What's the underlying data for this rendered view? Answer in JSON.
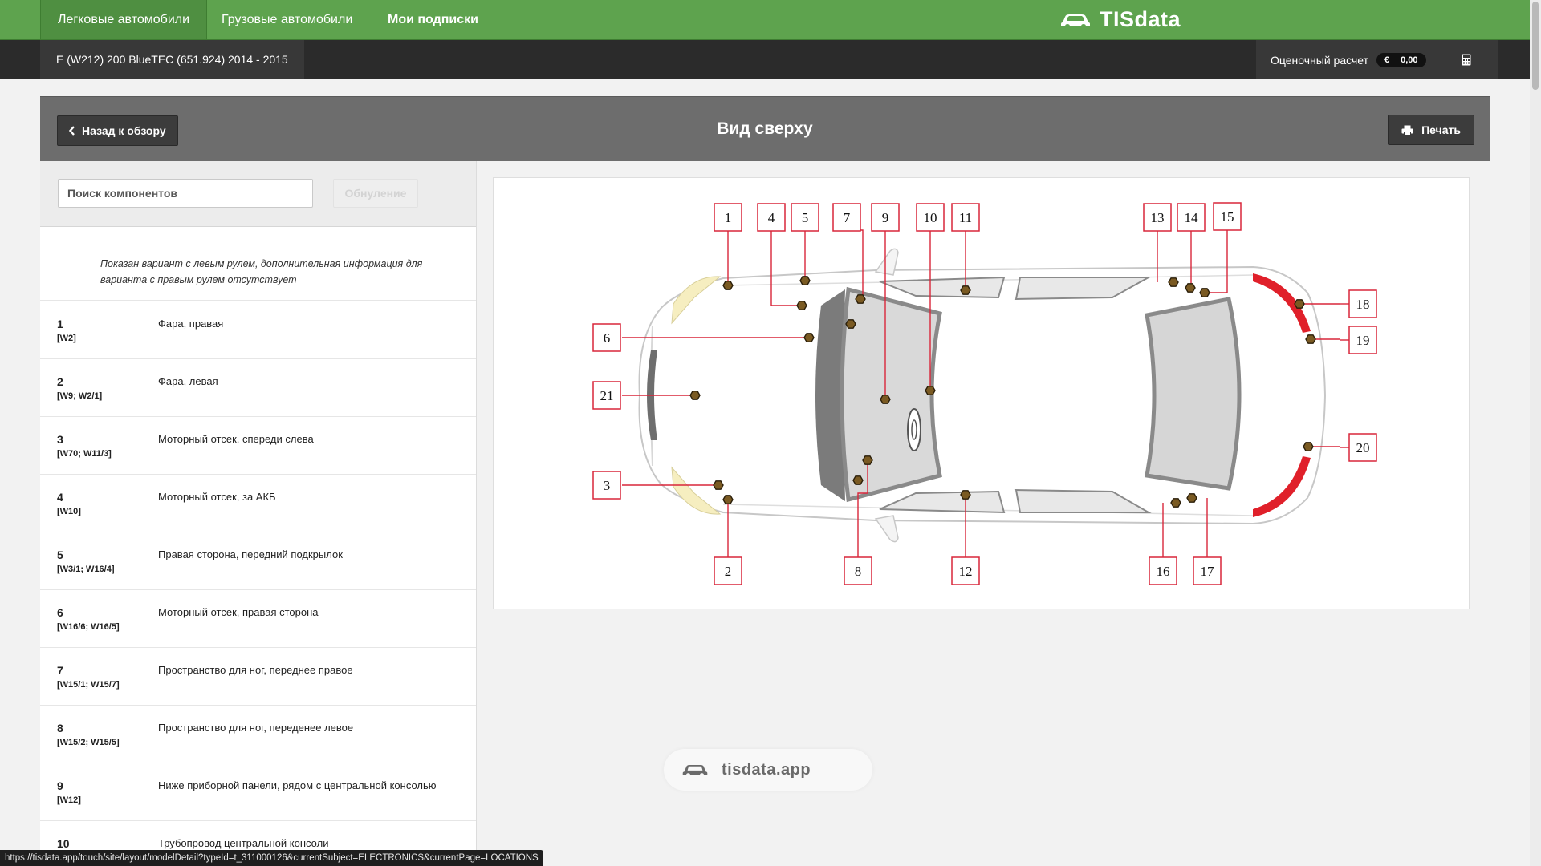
{
  "topnav": {
    "tabs": [
      {
        "label": "Легковые автомобили",
        "active": true
      },
      {
        "label": "Грузовые автомобили",
        "active": false
      },
      {
        "label": "Мои подписки",
        "active": false
      }
    ],
    "brand": "TISdata",
    "brand_icon": "car-icon"
  },
  "subbar": {
    "vehicle": "E (W212) 200 BlueTEC (651.924) 2014 - 2015",
    "estimate_label": "Оценочный расчет",
    "currency": "€",
    "amount": "0,00",
    "calc_icon": "calculator-icon"
  },
  "page": {
    "back_label": "Назад к обзору",
    "title": "Вид сверху",
    "print_label": "Печать"
  },
  "search": {
    "placeholder": "Поиск компонентов",
    "value": "",
    "reset_label": "Обнуление"
  },
  "note": "Показан вариант с левым рулем, дополнительная информация для варианта с правым рулем отсутствует",
  "components": [
    {
      "num": "1",
      "code": "[W2]",
      "desc": "Фара, правая"
    },
    {
      "num": "2",
      "code": "[W9; W2/1]",
      "desc": "Фара, левая"
    },
    {
      "num": "3",
      "code": "[W70; W11/3]",
      "desc": "Моторный отсек, спереди слева"
    },
    {
      "num": "4",
      "code": "[W10]",
      "desc": "Моторный отсек, за АКБ"
    },
    {
      "num": "5",
      "code": "[W3/1; W16/4]",
      "desc": "Правая сторона, передний подкрылок"
    },
    {
      "num": "6",
      "code": "[W16/6; W16/5]",
      "desc": "Моторный отсек, правая сторона"
    },
    {
      "num": "7",
      "code": "[W15/1; W15/7]",
      "desc": "Пространство для ног, переднее правое"
    },
    {
      "num": "8",
      "code": "[W15/2; W15/5]",
      "desc": "Пространство для ног, переденее левое"
    },
    {
      "num": "9",
      "code": "[W12]",
      "desc": "Ниже приборной панели, рядом с центральной консолью"
    },
    {
      "num": "10",
      "code": "",
      "desc": "Трубопровод центральной консоли"
    }
  ],
  "diagram": {
    "labels": [
      "1",
      "2",
      "3",
      "4",
      "5",
      "6",
      "7",
      "8",
      "9",
      "10",
      "11",
      "12",
      "13",
      "14",
      "15",
      "16",
      "17",
      "18",
      "19",
      "20",
      "21"
    ],
    "label_color": "#d9263a",
    "marker_color": "#7a5a22",
    "highlight_color": "#e0202a"
  },
  "watermark": "tisdata.app",
  "statusbar": "https://tisdata.app/touch/site/layout/modelDetail?typeId=t_311000126&currentSubject=ELECTRONICS&currentPage=LOCATIONS"
}
